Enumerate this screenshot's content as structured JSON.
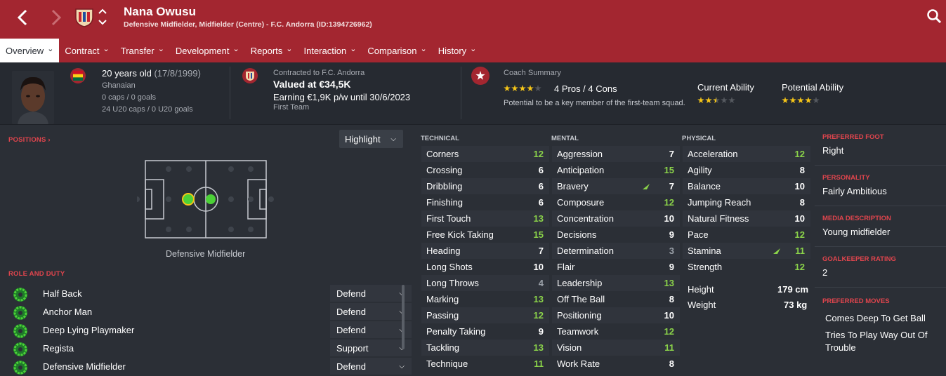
{
  "header": {
    "player_name": "Nana Owusu",
    "subtitle": "Defensive Midfielder, Midfielder (Centre) - F.C. Andorra (ID:1394726962)",
    "back_icon": "chevron-left-icon",
    "forward_icon": "chevron-right-icon",
    "search_icon": "search-icon",
    "accent": "#a32630"
  },
  "tabs": [
    {
      "label": "Overview",
      "active": true
    },
    {
      "label": "Contract"
    },
    {
      "label": "Transfer"
    },
    {
      "label": "Development"
    },
    {
      "label": "Reports"
    },
    {
      "label": "Interaction"
    },
    {
      "label": "Comparison"
    },
    {
      "label": "History"
    }
  ],
  "bio": {
    "age": "20 years old",
    "dob": "(17/8/1999)",
    "nationality": "Ghanaian",
    "caps": "0 caps / 0 goals",
    "u20_caps": "24 U20 caps / 0 U20 goals"
  },
  "contract": {
    "contracted_to": "Contracted to F.C. Andorra",
    "value": "Valued at €34,5K",
    "earning": "Earning €1,9K p/w until 30/6/2023",
    "squad": "First Team"
  },
  "coach": {
    "title": "Coach Summary",
    "pros_cons": "4 Pros / 4 Cons",
    "summary_stars": 4,
    "note": "Potential to be a key member of the first-team squad.",
    "current_ability_label": "Current Ability",
    "current_ability_stars": 2.5,
    "potential_ability_label": "Potential Ability",
    "potential_ability_stars": 4
  },
  "positions": {
    "title": "POSITIONS",
    "highlight_label": "Highlight",
    "position_label": "Defensive Midfielder"
  },
  "roles": {
    "title": "ROLE AND DUTY",
    "items": [
      {
        "label": "Half Back",
        "duty": "Defend"
      },
      {
        "label": "Anchor Man",
        "duty": "Defend"
      },
      {
        "label": "Deep Lying Playmaker",
        "duty": "Defend"
      },
      {
        "label": "Regista",
        "duty": "Support"
      },
      {
        "label": "Defensive Midfielder",
        "duty": "Defend"
      }
    ]
  },
  "technical": {
    "title": "TECHNICAL",
    "items": [
      {
        "name": "Corners",
        "value": "12"
      },
      {
        "name": "Crossing",
        "value": "6"
      },
      {
        "name": "Dribbling",
        "value": "6"
      },
      {
        "name": "Finishing",
        "value": "6"
      },
      {
        "name": "First Touch",
        "value": "13"
      },
      {
        "name": "Free Kick Taking",
        "value": "15"
      },
      {
        "name": "Heading",
        "value": "7"
      },
      {
        "name": "Long Shots",
        "value": "10"
      },
      {
        "name": "Long Throws",
        "value": "4"
      },
      {
        "name": "Marking",
        "value": "13"
      },
      {
        "name": "Passing",
        "value": "12"
      },
      {
        "name": "Penalty Taking",
        "value": "9"
      },
      {
        "name": "Tackling",
        "value": "13"
      },
      {
        "name": "Technique",
        "value": "11"
      }
    ]
  },
  "mental": {
    "title": "MENTAL",
    "items": [
      {
        "name": "Aggression",
        "value": "7"
      },
      {
        "name": "Anticipation",
        "value": "15"
      },
      {
        "name": "Bravery",
        "value": "7"
      },
      {
        "name": "Composure",
        "value": "12"
      },
      {
        "name": "Concentration",
        "value": "10"
      },
      {
        "name": "Decisions",
        "value": "9"
      },
      {
        "name": "Determination",
        "value": "3"
      },
      {
        "name": "Flair",
        "value": "9"
      },
      {
        "name": "Leadership",
        "value": "13"
      },
      {
        "name": "Off The Ball",
        "value": "8"
      },
      {
        "name": "Positioning",
        "value": "10"
      },
      {
        "name": "Teamwork",
        "value": "12"
      },
      {
        "name": "Vision",
        "value": "11"
      },
      {
        "name": "Work Rate",
        "value": "8"
      }
    ]
  },
  "physical": {
    "title": "PHYSICAL",
    "items": [
      {
        "name": "Acceleration",
        "value": "12"
      },
      {
        "name": "Agility",
        "value": "8"
      },
      {
        "name": "Balance",
        "value": "10"
      },
      {
        "name": "Jumping Reach",
        "value": "8"
      },
      {
        "name": "Natural Fitness",
        "value": "10"
      },
      {
        "name": "Pace",
        "value": "12"
      },
      {
        "name": "Stamina",
        "value": "11"
      },
      {
        "name": "Strength",
        "value": "12"
      }
    ],
    "height_label": "Height",
    "height_value": "179 cm",
    "weight_label": "Weight",
    "weight_value": "73 kg"
  },
  "details": {
    "preferred_foot_title": "PREFERRED FOOT",
    "preferred_foot": "Right",
    "personality_title": "PERSONALITY",
    "personality": "Fairly Ambitious",
    "media_title": "MEDIA DESCRIPTION",
    "media": "Young midfielder",
    "gk_title": "GOALKEEPER RATING",
    "gk": "2",
    "moves_title": "PREFERRED MOVES",
    "moves": [
      "Comes Deep To Get Ball",
      "Tries To Play Way Out Of Trouble"
    ]
  }
}
